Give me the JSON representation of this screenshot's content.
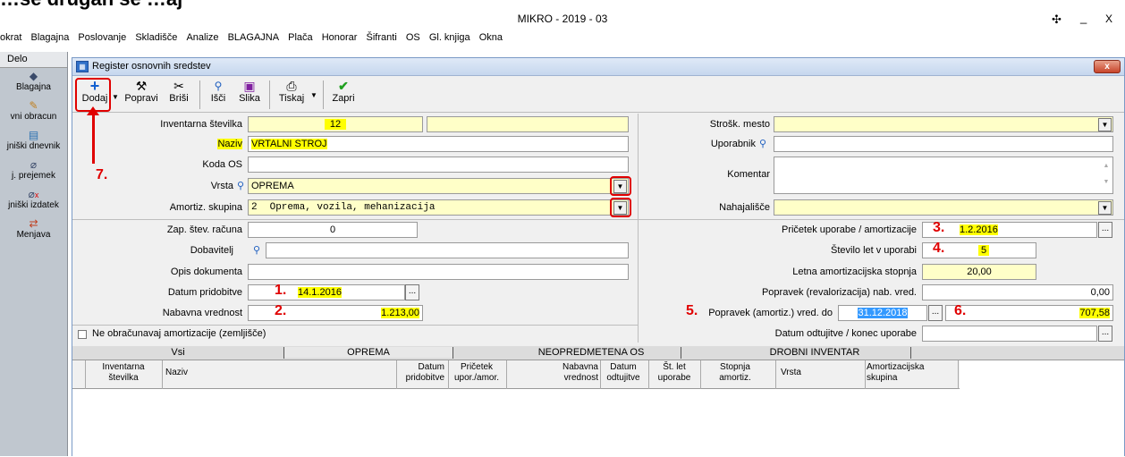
{
  "app_title": "MIKRO - 2019 - 03",
  "top_partial_text": "…se drugan se …aj",
  "title_controls": {
    "move": "✣",
    "minimize": "_",
    "close": "X"
  },
  "menu": [
    "okrat",
    "Blagajna",
    "Poslovanje",
    "Skladišče",
    "Analize",
    "BLAGAJNA",
    "Plača",
    "Honorar",
    "Šifranti",
    "OS",
    "Gl. knjiga",
    "Okna"
  ],
  "sidebar": {
    "header": "Delo",
    "items": [
      {
        "label": "Blagajna",
        "icon": "wallet-icon"
      },
      {
        "label": "vni obracun",
        "icon": "pen-icon"
      },
      {
        "label": "jniški dnevnik",
        "icon": "ledger-icon"
      },
      {
        "label": "j. prejemek",
        "icon": "receive-icon"
      },
      {
        "label": "jniški izdatek",
        "icon": "expense-icon"
      },
      {
        "label": "Menjava",
        "icon": "exchange-icon"
      }
    ]
  },
  "window": {
    "title": "Register osnovnih sredstev",
    "close": "x"
  },
  "toolbar": [
    {
      "label": "Dodaj",
      "icon": "plus-icon"
    },
    {
      "label": "Popravi",
      "icon": "hammer-icon"
    },
    {
      "label": "Briši",
      "icon": "scissors-icon"
    },
    {
      "label": "Išči",
      "icon": "search-icon"
    },
    {
      "label": "Slika",
      "icon": "image-icon"
    },
    {
      "label": "Tiskaj",
      "icon": "printer-icon"
    },
    {
      "label": "Zapri",
      "icon": "check-icon"
    }
  ],
  "form_left": {
    "inventarna_label": "Inventarna številka",
    "inventarna_value": "12",
    "naziv_label": "Naziv",
    "naziv_value": "VRTALNI STROJ",
    "koda_label": "Koda OS",
    "koda_value": "",
    "vrsta_label": "Vrsta",
    "vrsta_value": "OPREMA",
    "amort_label": "Amortiz. skupina",
    "amort_code": "2",
    "amort_value": "Oprema, vozila, mehanizacija",
    "zap_label": "Zap. štev. računa",
    "zap_value": "0",
    "dobavitelj_label": "Dobavitelj",
    "opis_label": "Opis dokumenta",
    "datum_label": "Datum pridobitve",
    "datum_value": "14.1.2016",
    "nabavna_label": "Nabavna vrednost",
    "nabavna_value": "1.213,00",
    "checkbox_label": "Ne obračunavaj amortizacije (zemljišče)"
  },
  "form_right": {
    "strosk_label": "Strošk. mesto",
    "uporabnik_label": "Uporabnik",
    "komentar_label": "Komentar",
    "nahajalisce_label": "Nahajališče",
    "pricetek_label": "Pričetek uporabe / amortizacije",
    "pricetek_value": "1.2.2016",
    "stevilo_label": "Število let v uporabi",
    "stevilo_value": "5",
    "letna_label": "Letna amortizacijska stopnja",
    "letna_value": "20,00",
    "popravek_reval_label": "Popravek (revalorizacija) nab. vred.",
    "popravek_reval_value": "0,00",
    "popravek_amort_label": "Popravek (amortiz.) vred. do",
    "popravek_amort_date": "31.12.2018",
    "popravek_amort_value": "707,58",
    "odtujitve_label": "Datum odtujitve / konec uporabe"
  },
  "annotations": [
    "1.",
    "2.",
    "3.",
    "4.",
    "5.",
    "6.",
    "7."
  ],
  "tabs": [
    "Vsi",
    "OPREMA",
    "NEOPREDMETENA OS",
    "DROBNI INVENTAR"
  ],
  "grid_columns": [
    "Inventarna številka",
    "Naziv",
    "Datum pridobitve",
    "Pričetek upor./amor.",
    "Nabavna vrednost",
    "Datum odtujitve",
    "Št. let uporabe",
    "Stopnja amortiz.",
    "Vrsta",
    "Amortizacijska skupina"
  ],
  "colors": {
    "highlight": "#ffff00",
    "field_yellow": "#ffffc8",
    "annotation_red": "#e00000",
    "selection_blue": "#3399ff"
  }
}
